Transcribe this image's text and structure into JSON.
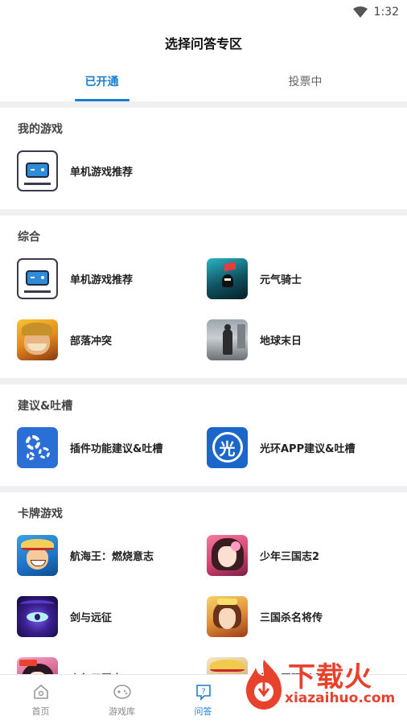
{
  "status_bar": {
    "time": "1:32"
  },
  "page": {
    "title": "选择问答专区"
  },
  "tabs": [
    {
      "label": "已开通",
      "active": true
    },
    {
      "label": "投票中",
      "active": false
    }
  ],
  "sections": {
    "mine": {
      "title": "我的游戏",
      "items": [
        {
          "label": "单机游戏推荐",
          "icon": "gamepad-icon"
        }
      ]
    },
    "general": {
      "title": "综合",
      "items": [
        {
          "label": "单机游戏推荐",
          "icon": "gamepad-icon"
        },
        {
          "label": "元气骑士",
          "icon": "soul-knight-icon"
        },
        {
          "label": "部落冲突",
          "icon": "clash-of-clans-icon"
        },
        {
          "label": "地球末日",
          "icon": "last-day-on-earth-icon"
        }
      ]
    },
    "feedback": {
      "title": "建议&吐槽",
      "items": [
        {
          "label": "插件功能建议&吐槽",
          "icon": "gear-icon"
        },
        {
          "label": "光环APP建议&吐槽",
          "icon": "guanghuan-app-icon"
        }
      ]
    },
    "cards": {
      "title": "卡牌游戏",
      "items": [
        {
          "label": "航海王：燃烧意志",
          "icon": "one-piece-icon"
        },
        {
          "label": "少年三国志2",
          "icon": "sanguo-girl-icon"
        },
        {
          "label": "剑与远征",
          "icon": "afk-arena-icon"
        },
        {
          "label": "三国杀名将传",
          "icon": "sanguosha-icon"
        },
        {
          "label": "少年三国志",
          "icon": "sanguo-girl-icon"
        },
        {
          "label": "航海王强者之路",
          "icon": "one-piece-icon"
        }
      ]
    }
  },
  "guang_glyph": "光",
  "bottom_nav": [
    {
      "label": "首页",
      "icon": "home-icon",
      "active": false
    },
    {
      "label": "游戏库",
      "icon": "gamepad-outline-icon",
      "active": false
    },
    {
      "label": "问答",
      "icon": "question-bubble-icon",
      "active": true
    }
  ],
  "watermark": {
    "text": "下载火",
    "url": "xiazaihuo.com"
  },
  "colors": {
    "accent": "#1a7ed0",
    "watermark": "#e8412c",
    "separator": "#f0f0f2"
  }
}
